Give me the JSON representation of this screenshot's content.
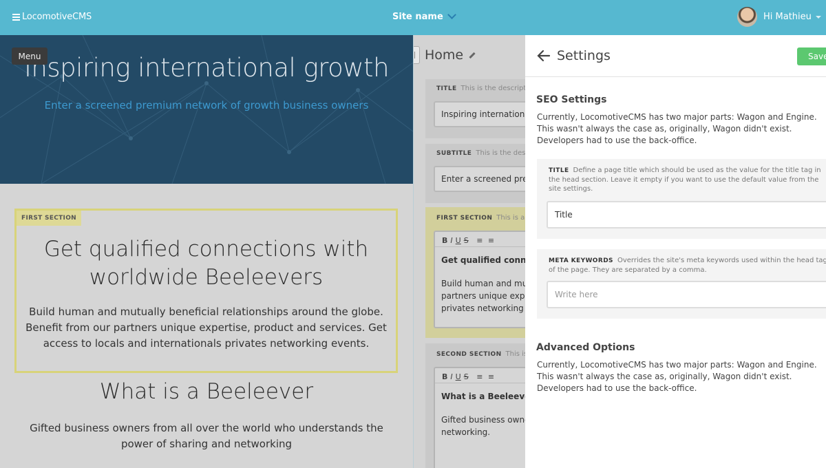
{
  "topbar": {
    "logo_text": "LocomotiveCMS",
    "site_name": "Site name",
    "greeting": "Hi Mathieu"
  },
  "preview": {
    "menu_label": "Menu",
    "hero_title": "Inspiring international growth",
    "hero_subtitle": "Enter a screened premium network of growth business owners",
    "first_section_tag": "FIRST SECTION",
    "first_section_title": "Get qualified connections with worldwide Beeleevers",
    "first_section_text": "Build human and mutually beneficial relationships around the globe. Benefit from our partners unique expertise, product and services. Get access to locals and internationals privates networking events.",
    "second_section_title": "What is a Beeleever",
    "second_section_text": "Gifted business owners from all over the world who understands the power of sharing and networking"
  },
  "editor": {
    "page_title": "Home",
    "fields": [
      {
        "label": "TITLE",
        "hint": "This is the description",
        "value": "Inspiring international growth"
      },
      {
        "label": "SUBTITLE",
        "hint": "This is the description",
        "value": "Enter a screened premium network"
      }
    ],
    "sections": [
      {
        "label": "FIRST SECTION",
        "hint": "This is a description",
        "heading": "Get qualified connections",
        "body_lines": [
          "Build human and mutually",
          "partners unique expertise",
          "privates networking events"
        ]
      },
      {
        "label": "SECOND SECTION",
        "hint": "This is a description",
        "heading": "What is a Beeleever",
        "body_lines": [
          "Gifted business owners",
          "networking."
        ]
      }
    ],
    "toolbar": {
      "bold": "B",
      "italic": "I",
      "underline": "U",
      "strike": "S"
    }
  },
  "settings": {
    "title": "Settings",
    "save_label": "Save",
    "seo_heading": "SEO Settings",
    "seo_text": "Currently, LocomotiveCMS has two major parts: Wagon and Engine. This wasn't always the case as, originally, Wagon didn't exist. Developers had to use the back-office.",
    "title_field": {
      "label": "TITLE",
      "hint": "Define a page title which should be used as the value for the title tag in the head section. Leave it empty if you want to use the default value from the site settings.",
      "value": "Title"
    },
    "keywords_field": {
      "label": "META KEYWORDS",
      "hint": "Overrides the site's meta keywords used within the head tag of the page. They are separated by a comma.",
      "placeholder": "Write here"
    },
    "advanced_heading": "Advanced Options",
    "advanced_text": "Currently, LocomotiveCMS has two major parts: Wagon and Engine. This wasn't always the case as, originally, Wagon didn't exist. Developers had to use the back-office."
  },
  "colors": {
    "topbar": "#56b8d0",
    "hero": "#234a66",
    "save": "#5cc870",
    "section_highlight": "#d8d37a"
  }
}
